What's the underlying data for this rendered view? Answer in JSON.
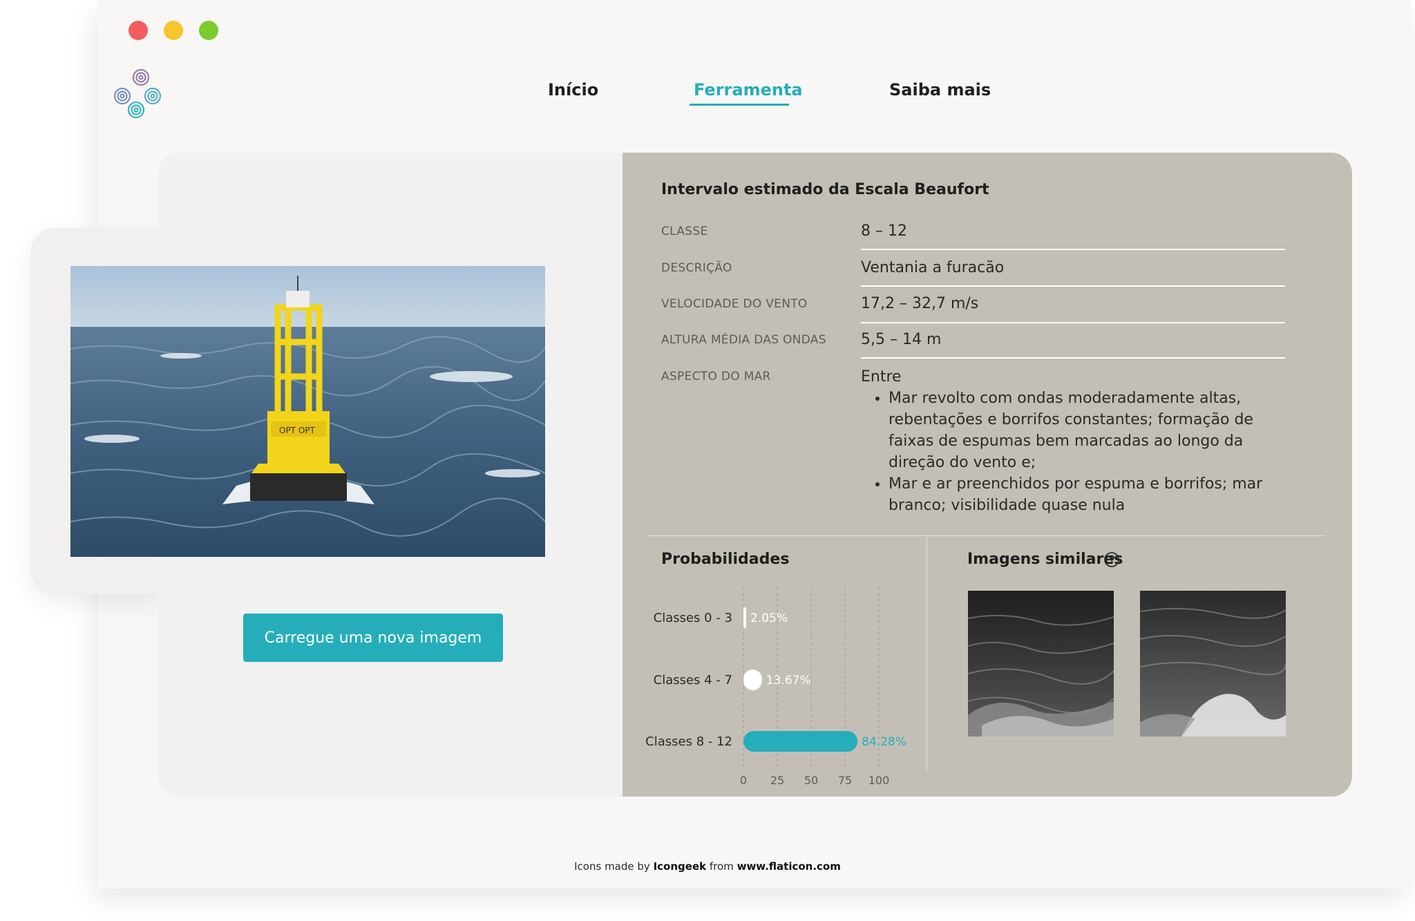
{
  "window": {
    "controls": [
      "close",
      "minimize",
      "maximize"
    ],
    "colors": {
      "close": "#f45b5e",
      "minimize": "#f8c531",
      "maximize": "#7ccb2d"
    }
  },
  "logo": {
    "icon": "spiral-circles-logo",
    "colors": [
      "#9b7bb0",
      "#4fb6c1"
    ]
  },
  "nav": {
    "items": [
      {
        "label": "Início",
        "active": false
      },
      {
        "label": "Ferramenta",
        "active": true
      },
      {
        "label": "Saiba mais",
        "active": false
      }
    ],
    "accent_color": "#25aeba"
  },
  "upload": {
    "button_label": "Carregue uma nova imagem"
  },
  "beaufort": {
    "title": "Intervalo estimado da Escala Beaufort",
    "rows": [
      {
        "label": "Classe",
        "value": "8 – 12"
      },
      {
        "label": "Descrição",
        "value": "Ventania a furacão"
      },
      {
        "label": "Velocidade do vento",
        "value": "17,2 – 32,7 m/s"
      },
      {
        "label": "Altura média das ondas",
        "value": "5,5 – 14 m"
      },
      {
        "label": "Aspecto do mar",
        "value": "Entre"
      }
    ],
    "sea_aspect_items": [
      "Mar revolto com ondas moderadamente altas, rebentações e borrifos constantes; formação de faixas de espumas bem marcadas ao longo da direção do vento e;",
      "Mar e ar preenchidos por espuma e borrifos; mar branco; visibilidade quase nula"
    ]
  },
  "probabilities": {
    "title": "Probabilidades"
  },
  "chart_data": {
    "type": "bar",
    "orientation": "horizontal",
    "categories": [
      "Classes 0 - 3",
      "Classes 4 - 7",
      "Classes 8 - 12"
    ],
    "values": [
      2.05,
      13.67,
      84.28
    ],
    "value_labels": [
      "2.05%",
      "13.67%",
      "84.28%"
    ],
    "xlim": [
      0,
      100
    ],
    "xticks": [
      "0",
      "25",
      "50",
      "75",
      "100"
    ],
    "grid": true,
    "bar_colors": [
      "#ffffff",
      "#ffffff",
      "#25aeba"
    ],
    "label_colors": [
      "#ffffff",
      "#ffffff",
      "#25aeba"
    ]
  },
  "similar": {
    "title": "Imagens similares",
    "help_icon": "question-circle-icon",
    "image_count": 2
  },
  "credit": {
    "prefix": "Icons made by",
    "author": "Icongeek",
    "middle": "from",
    "site": "www.flaticon.com"
  }
}
